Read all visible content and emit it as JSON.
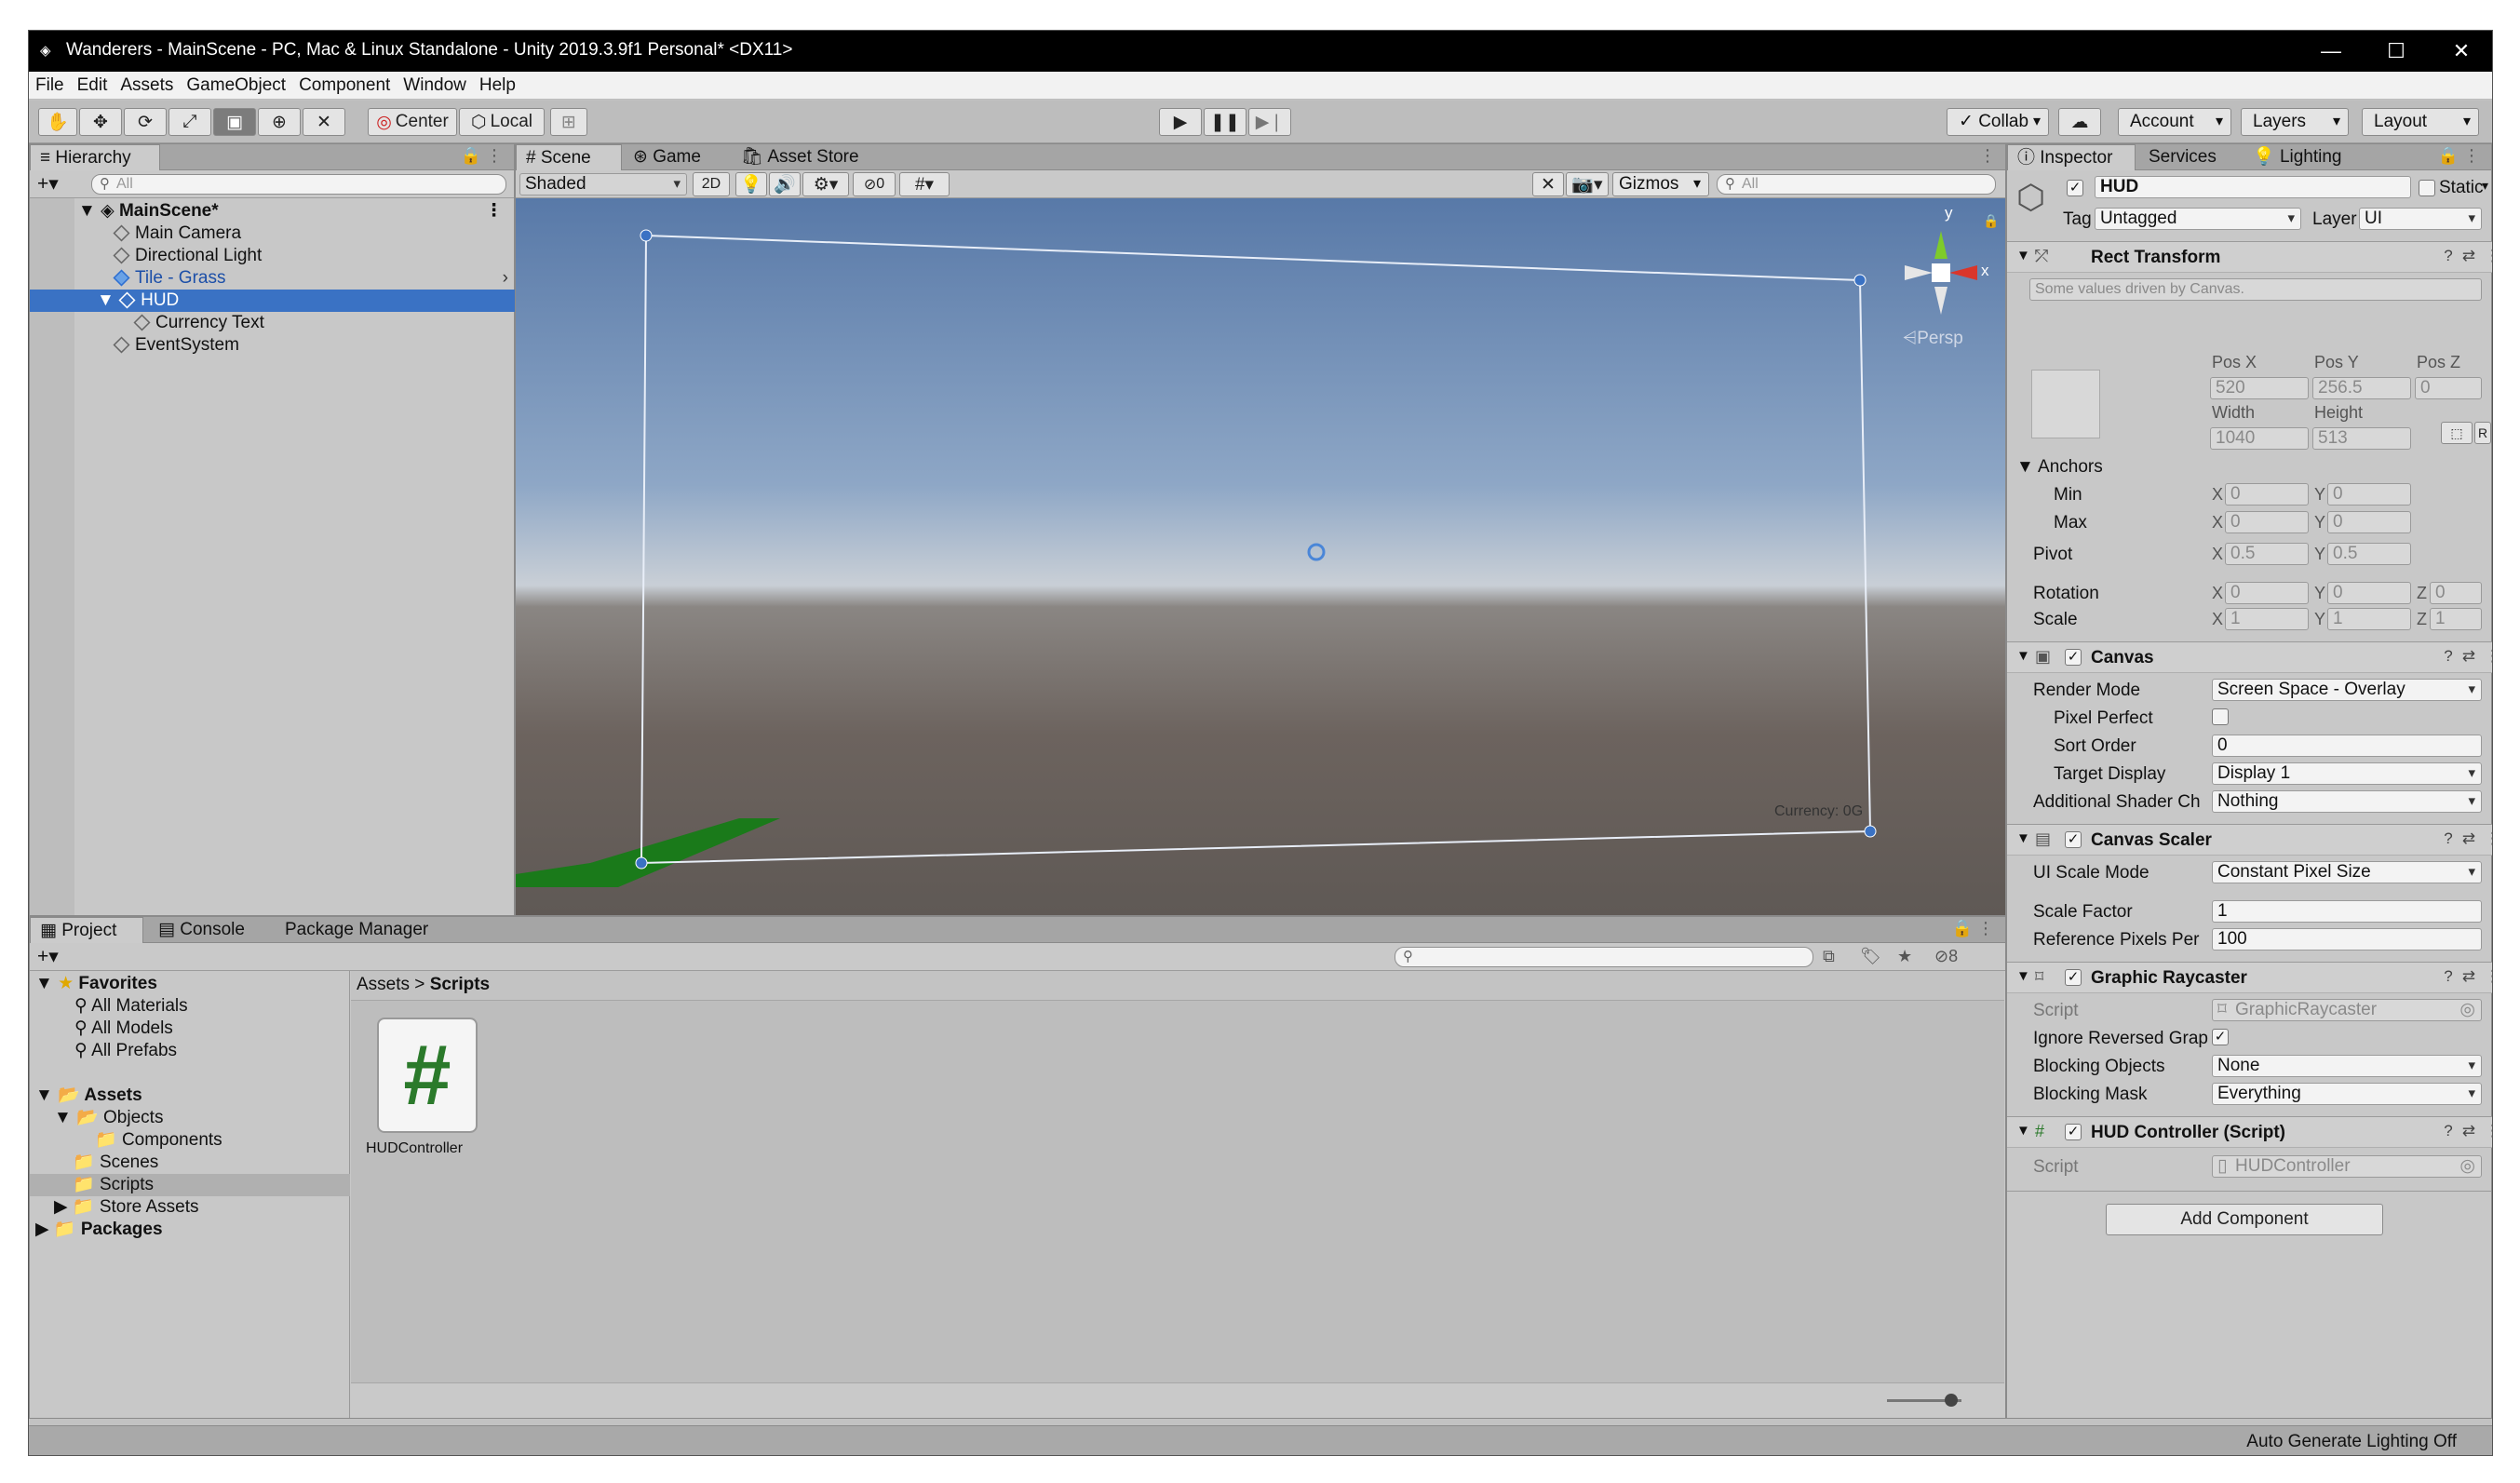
{
  "window": {
    "title": "Wanderers - MainScene - PC, Mac & Linux Standalone - Unity 2019.3.9f1 Personal* <DX11>",
    "controls": [
      "—",
      "☐",
      "✕"
    ]
  },
  "menu": [
    "File",
    "Edit",
    "Assets",
    "GameObject",
    "Component",
    "Window",
    "Help"
  ],
  "toolbar": {
    "center_label": "Center",
    "local_label": "Local",
    "collab_label": "Collab",
    "account_label": "Account",
    "layers_label": "Layers",
    "layout_label": "Layout"
  },
  "hierarchy": {
    "tab": "Hierarchy",
    "search_placeholder": "All",
    "scene": "MainScene*",
    "items": [
      "Main Camera",
      "Directional Light",
      "Tile - Grass",
      "HUD",
      "Currency Text",
      "EventSystem"
    ]
  },
  "scene": {
    "tabs": [
      "Scene",
      "Game",
      "Asset Store"
    ],
    "shading": "Shaded",
    "mode_2d": "2D",
    "hidden_count": "0",
    "gizmos": "Gizmos",
    "search_placeholder": "All",
    "persp": "Persp",
    "axis_y": "y",
    "axis_x": "x",
    "currency_label": "Currency: 0G"
  },
  "project": {
    "tabs": [
      "Project",
      "Console",
      "Package Manager"
    ],
    "hidden_count": "8",
    "favorites_title": "Favorites",
    "favorites": [
      "All Materials",
      "All Models",
      "All Prefabs"
    ],
    "assets_title": "Assets",
    "asset_tree": [
      "Objects",
      "Components",
      "Scenes",
      "Scripts",
      "Store Assets"
    ],
    "packages": "Packages",
    "breadcrumb": [
      "Assets",
      "Scripts"
    ],
    "file_name": "HUDController",
    "file_glyph": "#"
  },
  "inspector": {
    "tabs": [
      "Inspector",
      "Services",
      "Lighting"
    ],
    "object_name": "HUD",
    "static_label": "Static",
    "tag_label": "Tag",
    "tag_value": "Untagged",
    "layer_label": "Layer",
    "layer_value": "UI",
    "rect": {
      "title": "Rect Transform",
      "note": "Some values driven by Canvas.",
      "posx_label": "Pos X",
      "posy_label": "Pos Y",
      "posz_label": "Pos Z",
      "posx": "520",
      "posy": "256.5",
      "posz": "0",
      "width_label": "Width",
      "height_label": "Height",
      "width": "1040",
      "height": "513",
      "r_button": "R",
      "anchors_label": "Anchors",
      "min_label": "Min",
      "max_label": "Max",
      "pivot_label": "Pivot",
      "rotation_label": "Rotation",
      "scale_label": "Scale",
      "x_label": "X",
      "y_label": "Y",
      "z_label": "Z",
      "min_x": "0",
      "min_y": "0",
      "max_x": "0",
      "max_y": "0",
      "pivot_x": "0.5",
      "pivot_y": "0.5",
      "rot_x": "0",
      "rot_y": "0",
      "rot_z": "0",
      "scale_x": "1",
      "scale_y": "1",
      "scale_z": "1"
    },
    "canvas": {
      "title": "Canvas",
      "render_mode_label": "Render Mode",
      "render_mode": "Screen Space - Overlay",
      "pixel_perfect_label": "Pixel Perfect",
      "sort_order_label": "Sort Order",
      "sort_order": "0",
      "target_display_label": "Target Display",
      "target_display": "Display 1",
      "shader_label": "Additional Shader Ch",
      "shader_value": "Nothing"
    },
    "scaler": {
      "title": "Canvas Scaler",
      "mode_label": "UI Scale Mode",
      "mode": "Constant Pixel Size",
      "factor_label": "Scale Factor",
      "factor": "1",
      "ref_label": "Reference Pixels Per",
      "ref": "100"
    },
    "raycaster": {
      "title": "Graphic Raycaster",
      "script_label": "Script",
      "script": "GraphicRaycaster",
      "ignore_label": "Ignore Reversed Grap",
      "blocking_label": "Blocking Objects",
      "blocking": "None",
      "mask_label": "Blocking Mask",
      "mask": "Everything"
    },
    "hud_script": {
      "title": "HUD Controller (Script)",
      "script_label": "Script",
      "script": "HUDController"
    },
    "add_component": "Add Component"
  },
  "status": "Auto Generate Lighting Off",
  "colors": {
    "selection": "#3a72c4",
    "sky_top": "#5879a8",
    "horizon": "#c9cfd6",
    "ground": "#6c635e",
    "grass": "#1a7a1a"
  }
}
